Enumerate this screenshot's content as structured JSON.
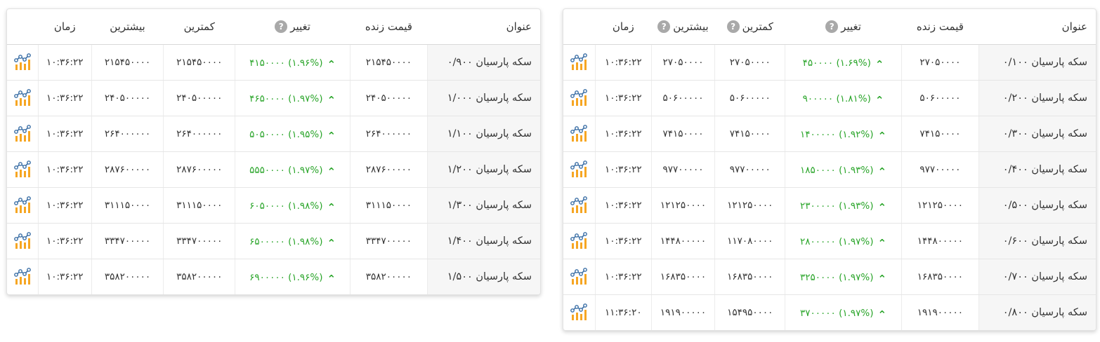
{
  "tables": [
    {
      "id": "left",
      "headers": {
        "title": "عنوان",
        "live_price": "قیمت زنده",
        "change": "تغییر",
        "low": "کمترین",
        "high": "بیشترین",
        "time": "زمان"
      },
      "help_on": [
        "change"
      ],
      "rows": [
        {
          "title": "سکه پارسیان ۰/۹۰۰",
          "price": "۲۱۵۴۵۰۰۰۰",
          "change": "۴۱۵۰۰۰۰ (۱.۹۶%)",
          "low": "۲۱۵۴۵۰۰۰۰",
          "high": "۲۱۵۴۵۰۰۰۰",
          "time": "۱۰:۳۶:۲۲"
        },
        {
          "title": "سکه پارسیان ۱/۰۰۰",
          "price": "۲۴۰۵۰۰۰۰۰",
          "change": "۴۶۵۰۰۰۰ (۱.۹۷%)",
          "low": "۲۴۰۵۰۰۰۰۰",
          "high": "۲۴۰۵۰۰۰۰۰",
          "time": "۱۰:۳۶:۲۲"
        },
        {
          "title": "سکه پارسیان ۱/۱۰۰",
          "price": "۲۶۴۰۰۰۰۰۰",
          "change": "۵۰۵۰۰۰۰ (۱.۹۵%)",
          "low": "۲۶۴۰۰۰۰۰۰",
          "high": "۲۶۴۰۰۰۰۰۰",
          "time": "۱۰:۳۶:۲۲"
        },
        {
          "title": "سکه پارسیان ۱/۲۰۰",
          "price": "۲۸۷۶۰۰۰۰۰",
          "change": "۵۵۵۰۰۰۰ (۱.۹۷%)",
          "low": "۲۸۷۶۰۰۰۰۰",
          "high": "۲۸۷۶۰۰۰۰۰",
          "time": "۱۰:۳۶:۲۲"
        },
        {
          "title": "سکه پارسیان ۱/۳۰۰",
          "price": "۳۱۱۱۵۰۰۰۰",
          "change": "۶۰۵۰۰۰۰ (۱.۹۸%)",
          "low": "۳۱۱۱۵۰۰۰۰",
          "high": "۳۱۱۱۵۰۰۰۰",
          "time": "۱۰:۳۶:۲۲"
        },
        {
          "title": "سکه پارسیان ۱/۴۰۰",
          "price": "۳۳۴۷۰۰۰۰۰",
          "change": "۶۵۰۰۰۰۰ (۱.۹۸%)",
          "low": "۳۳۴۷۰۰۰۰۰",
          "high": "۳۳۴۷۰۰۰۰۰",
          "time": "۱۰:۳۶:۲۲"
        },
        {
          "title": "سکه پارسیان ۱/۵۰۰",
          "price": "۳۵۸۲۰۰۰۰۰",
          "change": "۶۹۰۰۰۰۰ (۱.۹۶%)",
          "low": "۳۵۸۲۰۰۰۰۰",
          "high": "۳۵۸۲۰۰۰۰۰",
          "time": "۱۰:۳۶:۲۲"
        }
      ]
    },
    {
      "id": "right",
      "headers": {
        "title": "عنوان",
        "live_price": "قیمت زنده",
        "change": "تغییر",
        "low": "کمترین",
        "high": "بیشترین",
        "time": "زمان"
      },
      "help_on": [
        "change",
        "low",
        "high"
      ],
      "rows": [
        {
          "title": "سکه پارسیان ۰/۱۰۰",
          "price": "۲۷۰۵۰۰۰۰",
          "change": "۴۵۰۰۰۰ (۱.۶۹%)",
          "low": "۲۷۰۵۰۰۰۰",
          "high": "۲۷۰۵۰۰۰۰",
          "time": "۱۰:۳۶:۲۲"
        },
        {
          "title": "سکه پارسیان ۰/۲۰۰",
          "price": "۵۰۶۰۰۰۰۰",
          "change": "۹۰۰۰۰۰ (۱.۸۱%)",
          "low": "۵۰۶۰۰۰۰۰",
          "high": "۵۰۶۰۰۰۰۰",
          "time": "۱۰:۳۶:۲۲"
        },
        {
          "title": "سکه پارسیان ۰/۳۰۰",
          "price": "۷۴۱۵۰۰۰۰",
          "change": "۱۴۰۰۰۰۰ (۱.۹۲%)",
          "low": "۷۴۱۵۰۰۰۰",
          "high": "۷۴۱۵۰۰۰۰",
          "time": "۱۰:۳۶:۲۲"
        },
        {
          "title": "سکه پارسیان ۰/۴۰۰",
          "price": "۹۷۷۰۰۰۰۰",
          "change": "۱۸۵۰۰۰۰ (۱.۹۳%)",
          "low": "۹۷۷۰۰۰۰۰",
          "high": "۹۷۷۰۰۰۰۰",
          "time": "۱۰:۳۶:۲۲"
        },
        {
          "title": "سکه پارسیان ۰/۵۰۰",
          "price": "۱۲۱۲۵۰۰۰۰",
          "change": "۲۳۰۰۰۰۰ (۱.۹۳%)",
          "low": "۱۲۱۲۵۰۰۰۰",
          "high": "۱۲۱۲۵۰۰۰۰",
          "time": "۱۰:۳۶:۲۲"
        },
        {
          "title": "سکه پارسیان ۰/۶۰۰",
          "price": "۱۴۴۸۰۰۰۰۰",
          "change": "۲۸۰۰۰۰۰ (۱.۹۷%)",
          "low": "۱۱۷۰۸۰۰۰۰",
          "high": "۱۴۴۸۰۰۰۰۰",
          "time": "۱۰:۳۶:۲۲"
        },
        {
          "title": "سکه پارسیان ۰/۷۰۰",
          "price": "۱۶۸۳۵۰۰۰۰",
          "change": "۳۲۵۰۰۰۰ (۱.۹۷%)",
          "low": "۱۶۸۳۵۰۰۰۰",
          "high": "۱۶۸۳۵۰۰۰۰",
          "time": "۱۰:۳۶:۲۲"
        },
        {
          "title": "سکه پارسیان ۰/۸۰۰",
          "price": "۱۹۱۹۰۰۰۰۰",
          "change": "۳۷۰۰۰۰۰ (۱.۹۷%)",
          "low": "۱۵۴۹۵۰۰۰۰",
          "high": "۱۹۱۹۰۰۰۰۰",
          "time": "۱۱:۳۶:۲۰"
        }
      ]
    }
  ],
  "colors": {
    "positive": "#2aa52a",
    "help_badge": "#a9a9a9",
    "title_bg": "#f6f6f6"
  },
  "icons": {
    "help": "question-mark-icon",
    "chart": "chart-icon",
    "up_arrow": "caret-up-icon"
  },
  "help_glyph": "?"
}
